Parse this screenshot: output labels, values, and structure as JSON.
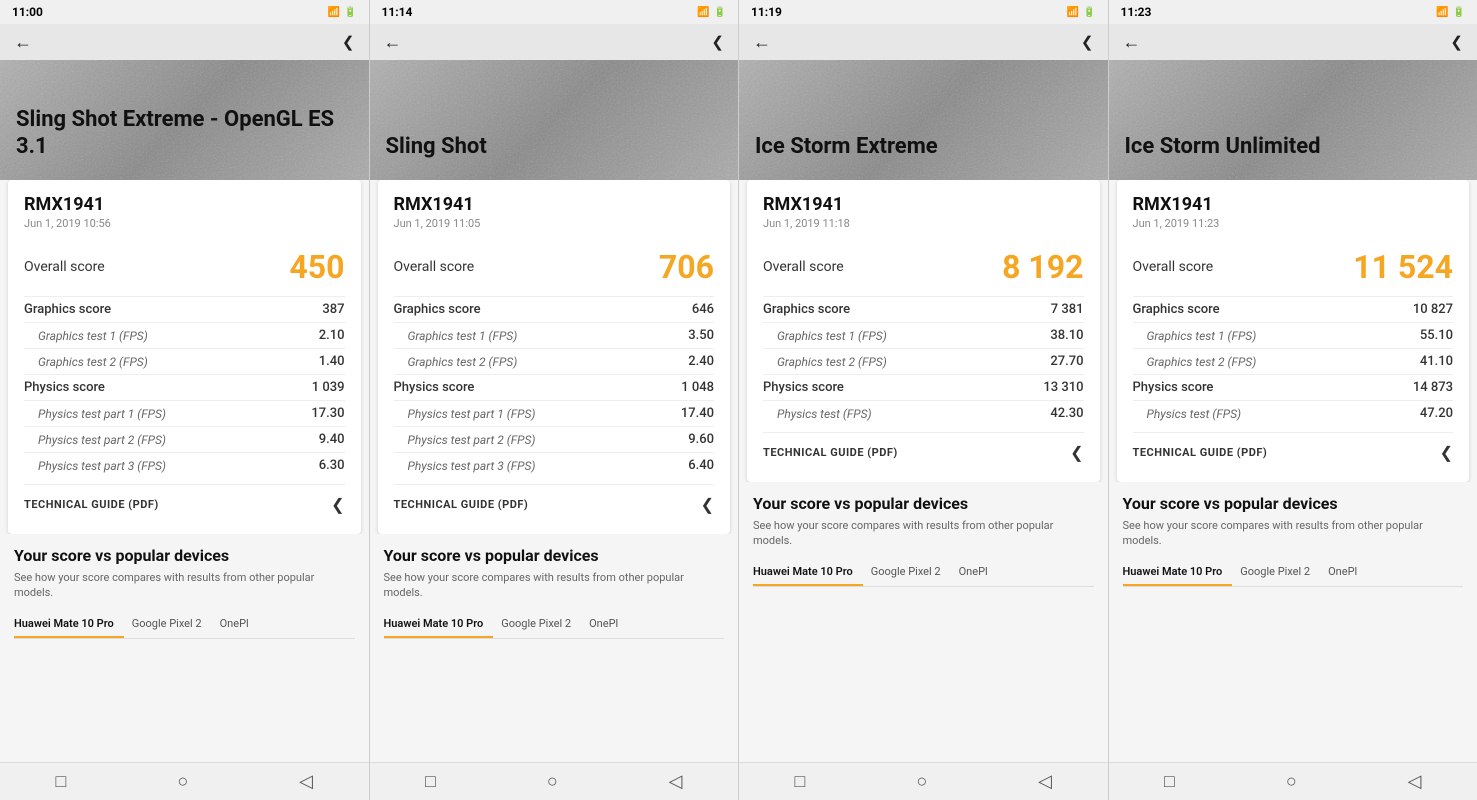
{
  "panels": [
    {
      "id": "panel-1",
      "status": {
        "time": "11:00",
        "signal": "▂▄▆",
        "battery": "🔋"
      },
      "benchmark_name": "Sling Shot Extreme - OpenGL ES 3.1",
      "device_name": "RMX1941",
      "device_date": "Jun 1, 2019 10:56",
      "overall_label": "Overall score",
      "overall_score": "450",
      "rows": [
        {
          "label": "Graphics score",
          "value": "387",
          "sub": false
        },
        {
          "label": "Graphics test 1 (FPS)",
          "value": "2.10",
          "sub": true
        },
        {
          "label": "Graphics test 2 (FPS)",
          "value": "1.40",
          "sub": true
        },
        {
          "label": "Physics score",
          "value": "1 039",
          "sub": false
        },
        {
          "label": "Physics test part 1 (FPS)",
          "value": "17.30",
          "sub": true
        },
        {
          "label": "Physics test part 2 (FPS)",
          "value": "9.40",
          "sub": true
        },
        {
          "label": "Physics test part 3 (FPS)",
          "value": "6.30",
          "sub": true
        }
      ],
      "technical_guide": "TECHNICAL GUIDE (PDF)",
      "popular_title": "Your score vs popular devices",
      "popular_subtitle": "See how your score compares with results from other popular models.",
      "device_tabs": [
        "Huawei Mate 10 Pro",
        "Google Pixel 2",
        "OnePl"
      ]
    },
    {
      "id": "panel-2",
      "status": {
        "time": "11:14",
        "signal": "▂▄▆",
        "battery": "🔋"
      },
      "benchmark_name": "Sling Shot",
      "device_name": "RMX1941",
      "device_date": "Jun 1, 2019 11:05",
      "overall_label": "Overall score",
      "overall_score": "706",
      "rows": [
        {
          "label": "Graphics score",
          "value": "646",
          "sub": false
        },
        {
          "label": "Graphics test 1 (FPS)",
          "value": "3.50",
          "sub": true
        },
        {
          "label": "Graphics test 2 (FPS)",
          "value": "2.40",
          "sub": true
        },
        {
          "label": "Physics score",
          "value": "1 048",
          "sub": false
        },
        {
          "label": "Physics test part 1 (FPS)",
          "value": "17.40",
          "sub": true
        },
        {
          "label": "Physics test part 2 (FPS)",
          "value": "9.60",
          "sub": true
        },
        {
          "label": "Physics test part 3 (FPS)",
          "value": "6.40",
          "sub": true
        }
      ],
      "technical_guide": "TECHNICAL GUIDE (PDF)",
      "popular_title": "Your score vs popular devices",
      "popular_subtitle": "See how your score compares with results from other popular models.",
      "device_tabs": [
        "Huawei Mate 10 Pro",
        "Google Pixel 2",
        "OnePl"
      ]
    },
    {
      "id": "panel-3",
      "status": {
        "time": "11:19",
        "signal": "▂▄▆",
        "battery": "🔋"
      },
      "benchmark_name": "Ice Storm Extreme",
      "device_name": "RMX1941",
      "device_date": "Jun 1, 2019 11:18",
      "overall_label": "Overall score",
      "overall_score": "8 192",
      "rows": [
        {
          "label": "Graphics score",
          "value": "7 381",
          "sub": false
        },
        {
          "label": "Graphics test 1 (FPS)",
          "value": "38.10",
          "sub": true
        },
        {
          "label": "Graphics test 2 (FPS)",
          "value": "27.70",
          "sub": true
        },
        {
          "label": "Physics score",
          "value": "13 310",
          "sub": false
        },
        {
          "label": "Physics test (FPS)",
          "value": "42.30",
          "sub": true
        }
      ],
      "technical_guide": "TECHNICAL GUIDE (PDF)",
      "popular_title": "Your score vs popular devices",
      "popular_subtitle": "See how your score compares with results from other popular models.",
      "device_tabs": [
        "Huawei Mate 10 Pro",
        "Google Pixel 2",
        "OnePl"
      ]
    },
    {
      "id": "panel-4",
      "status": {
        "time": "11:23",
        "signal": "▂▄▆",
        "battery": "🔋"
      },
      "benchmark_name": "Ice Storm Unlimited",
      "device_name": "RMX1941",
      "device_date": "Jun 1, 2019 11:23",
      "overall_label": "Overall score",
      "overall_score": "11 524",
      "rows": [
        {
          "label": "Graphics score",
          "value": "10 827",
          "sub": false
        },
        {
          "label": "Graphics test 1 (FPS)",
          "value": "55.10",
          "sub": true
        },
        {
          "label": "Graphics test 2 (FPS)",
          "value": "41.10",
          "sub": true
        },
        {
          "label": "Physics score",
          "value": "14 873",
          "sub": false
        },
        {
          "label": "Physics test (FPS)",
          "value": "47.20",
          "sub": true
        }
      ],
      "technical_guide": "TECHNICAL GUIDE (PDF)",
      "popular_title": "Your score vs popular devices",
      "popular_subtitle": "See how your score compares with results from other popular models.",
      "device_tabs": [
        "Huawei Mate 10 Pro",
        "Google Pixel 2",
        "OnePl"
      ]
    }
  ],
  "ui": {
    "back_icon": "←",
    "share_icon": "⟨",
    "share_icon_alt": "◁",
    "bottom_square": "□",
    "bottom_circle": "○",
    "bottom_triangle": "◁"
  }
}
